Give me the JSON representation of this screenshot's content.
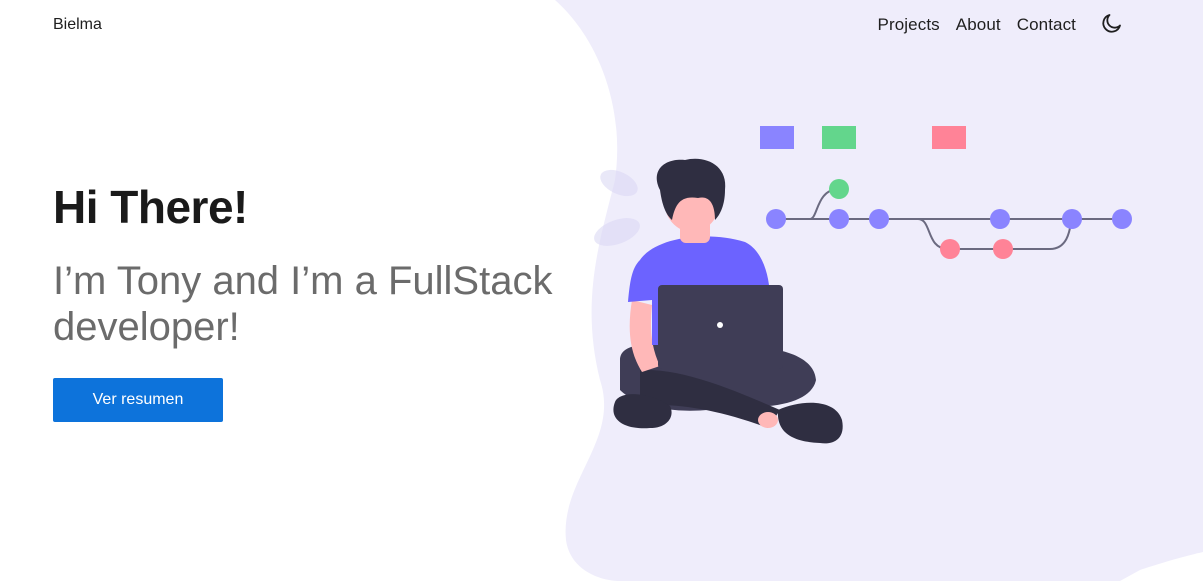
{
  "nav": {
    "brand": "Bielma",
    "links": [
      {
        "label": "Projects"
      },
      {
        "label": "About"
      },
      {
        "label": "Contact"
      }
    ],
    "theme_icon": "moon-icon"
  },
  "hero": {
    "title": "Hi There!",
    "subtitle": "I’m Tony and I’m a FullStack developer!",
    "button_label": "Ver resumen"
  },
  "colors": {
    "accent": "#0d73db",
    "blob": "#efedfb",
    "purple": "#8a84ff",
    "green": "#63d68c",
    "pink": "#ff8397",
    "dark": "#3f3d56"
  }
}
